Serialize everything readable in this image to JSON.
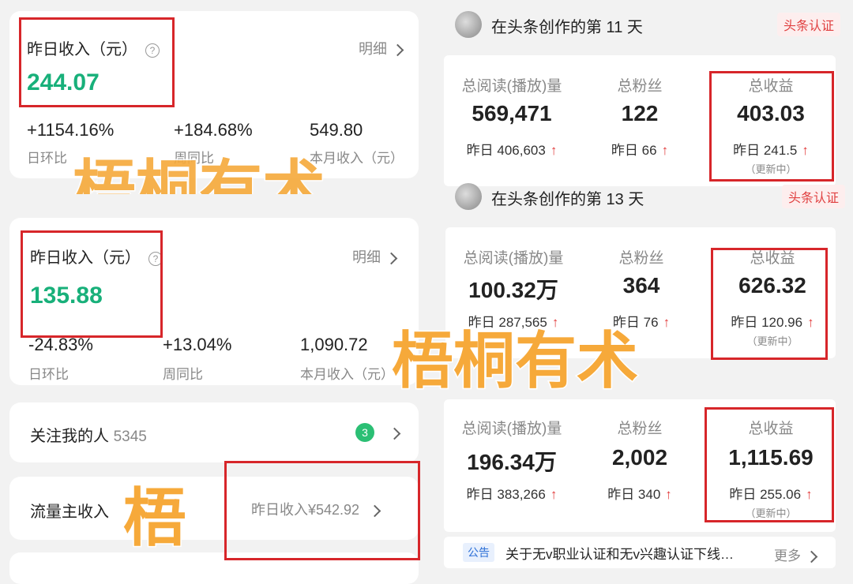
{
  "left_card1": {
    "title": "昨日收入（元）",
    "help_icon": "?",
    "detail_label": "明细",
    "value": "244.07",
    "metrics": [
      {
        "value": "+1154.16%",
        "label": "日环比"
      },
      {
        "value": "+184.68%",
        "label": "周同比"
      },
      {
        "value": "549.80",
        "label": "本月收入（元）"
      }
    ]
  },
  "left_card2": {
    "title": "昨日收入（元）",
    "help_icon": "?",
    "detail_label": "明细",
    "value": "135.88",
    "metrics": [
      {
        "value": "-24.83%",
        "label": "日环比"
      },
      {
        "value": "+13.04%",
        "label": "周同比"
      },
      {
        "value": "1,090.72",
        "label": "本月收入（元）"
      }
    ]
  },
  "followers_row": {
    "label": "关注我的人",
    "count": "5345",
    "badge": "3"
  },
  "traffic_row": {
    "label": "流量主收入",
    "value": "昨日收入¥542.92"
  },
  "right_header1": {
    "title": "在头条创作的第 11 天",
    "badge": "头条认证"
  },
  "right_header2": {
    "title": "在头条创作的第 13 天",
    "badge": "头条认证"
  },
  "stats": [
    {
      "reads_title": "总阅读(播放)量",
      "reads": "569,471",
      "reads_y": "昨日 406,603",
      "fans_title": "总粉丝",
      "fans": "122",
      "fans_y": "昨日 66",
      "income_title": "总收益",
      "income": "403.03",
      "income_y": "昨日 241.5",
      "updating": "（更新中）"
    },
    {
      "reads_title": "总阅读(播放)量",
      "reads": "100.32万",
      "reads_y": "昨日 287,565",
      "fans_title": "总粉丝",
      "fans": "364",
      "fans_y": "昨日 76",
      "income_title": "总收益",
      "income": "626.32",
      "income_y": "昨日 120.96",
      "updating": "（更新中）"
    },
    {
      "reads_title": "总阅读(播放)量",
      "reads": "196.34万",
      "reads_y": "昨日 383,266",
      "fans_title": "总粉丝",
      "fans": "2,002",
      "fans_y": "昨日 340",
      "income_title": "总收益",
      "income": "1,115.69",
      "income_y": "昨日 255.06",
      "updating": "（更新中）"
    }
  ],
  "notice": {
    "tag": "公告",
    "text": "关于无v职业认证和无v兴趣认证下线…",
    "more": "更多"
  },
  "arrow": "↑",
  "watermarks": {
    "big": "梧桐有术",
    "single": "梧"
  },
  "colors": {
    "accent_green": "#18b07a",
    "highlight_red": "#d7262a",
    "watermark_orange": "#f6a93a"
  }
}
